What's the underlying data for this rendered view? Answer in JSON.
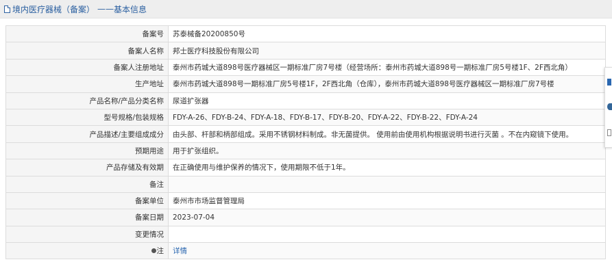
{
  "header": {
    "title": "境内医疗器械（备案）",
    "separator": "——",
    "subtitle": "基本信息"
  },
  "rows": [
    {
      "label": "备案号",
      "value": "苏泰械备20200850号"
    },
    {
      "label": "备案人名称",
      "value": "邦士医疗科技股份有限公司"
    },
    {
      "label": "备案人注册地址",
      "value": "泰州市药城大道898号医疗器械区一期标准厂房7号楼（经营场所：泰州市药城大道898号一期标准厂房5号楼1F、2F西北角）"
    },
    {
      "label": "生产地址",
      "value": "泰州市药城大道898号一期标准厂房5号楼1F，2F西北角（仓库），泰州市药城大道898号医疗器械区一期标准厂房7号楼"
    },
    {
      "label": "产品名称/产品分类名称",
      "value": "尿道扩张器"
    },
    {
      "label": "型号规格/包装规格",
      "value": "FDY-A-26、FDY-B-24、FDY-A-18、FDY-B-17、FDY-B-20、FDY-A-22、FDY-B-22、FDY-A-24"
    },
    {
      "label": "产品描述/主要组成成分",
      "value": "由头部、杆部和柄部组成。采用不锈钢材料制成。非无菌提供。 使用前由使用机构根据说明书进行灭菌 。不在内窥镜下使用。"
    },
    {
      "label": "预期用途",
      "value": "用于扩张组织。"
    },
    {
      "label": "产品存储及有效期",
      "value": "在正确使用与维护保养的情况下，使用期限不低于1年。"
    },
    {
      "label": "备注",
      "value": ""
    },
    {
      "label": "备案单位",
      "value": "泰州市市场监督管理局"
    },
    {
      "label": "备案日期",
      "value": "2023-07-04"
    },
    {
      "label": "变更情况",
      "value": ""
    }
  ],
  "note_row": {
    "label": "注",
    "link": "详情",
    "icon": "pin-icon"
  }
}
